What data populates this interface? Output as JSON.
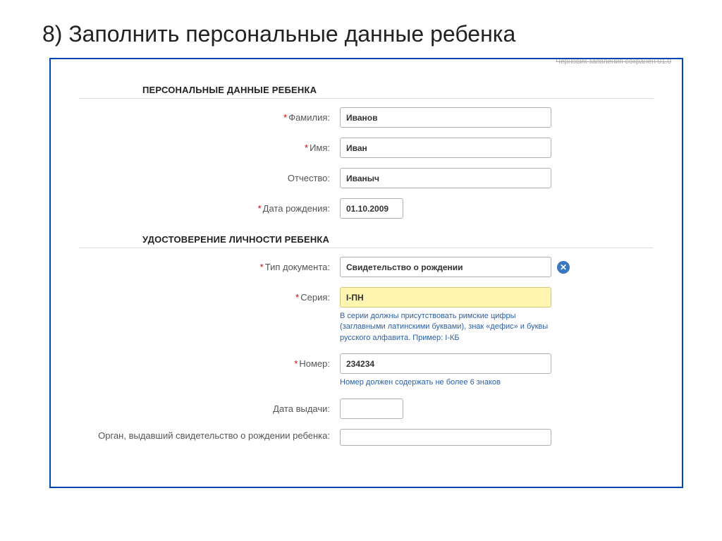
{
  "slide": {
    "title": "8) Заполнить персональные данные ребенка"
  },
  "draft_note": "Черновик заявления сохранен 01.0",
  "sections": {
    "personal": {
      "title": "ПЕРСОНАЛЬНЫЕ ДАННЫЕ РЕБЕНКА",
      "surname_label": "Фамилия:",
      "surname_value": "Иванов",
      "name_label": "Имя:",
      "name_value": "Иван",
      "patronymic_label": "Отчество:",
      "patronymic_value": "Иваныч",
      "dob_label": "Дата рождения:",
      "dob_value": "01.10.2009"
    },
    "identity": {
      "title": "УДОСТОВЕРЕНИЕ ЛИЧНОСТИ РЕБЕНКА",
      "doctype_label": "Тип документа:",
      "doctype_value": "Свидетельство о рождении",
      "series_label": "Серия:",
      "series_value": "I-ПН",
      "series_hint": "В серии должны присутствовать римские цифры (заглавными латинскими буквами), знак «дефис» и буквы русского алфавита. Пример: I-КБ",
      "number_label": "Номер:",
      "number_value": "234234",
      "number_hint": "Номер должен содержать не более 6 знаков",
      "issue_date_label": "Дата выдачи:",
      "issue_date_value": "",
      "issuer_label": "Орган, выдавший свидетельство о рождении ребенка:",
      "issuer_value": ""
    }
  },
  "required_mark": "*"
}
